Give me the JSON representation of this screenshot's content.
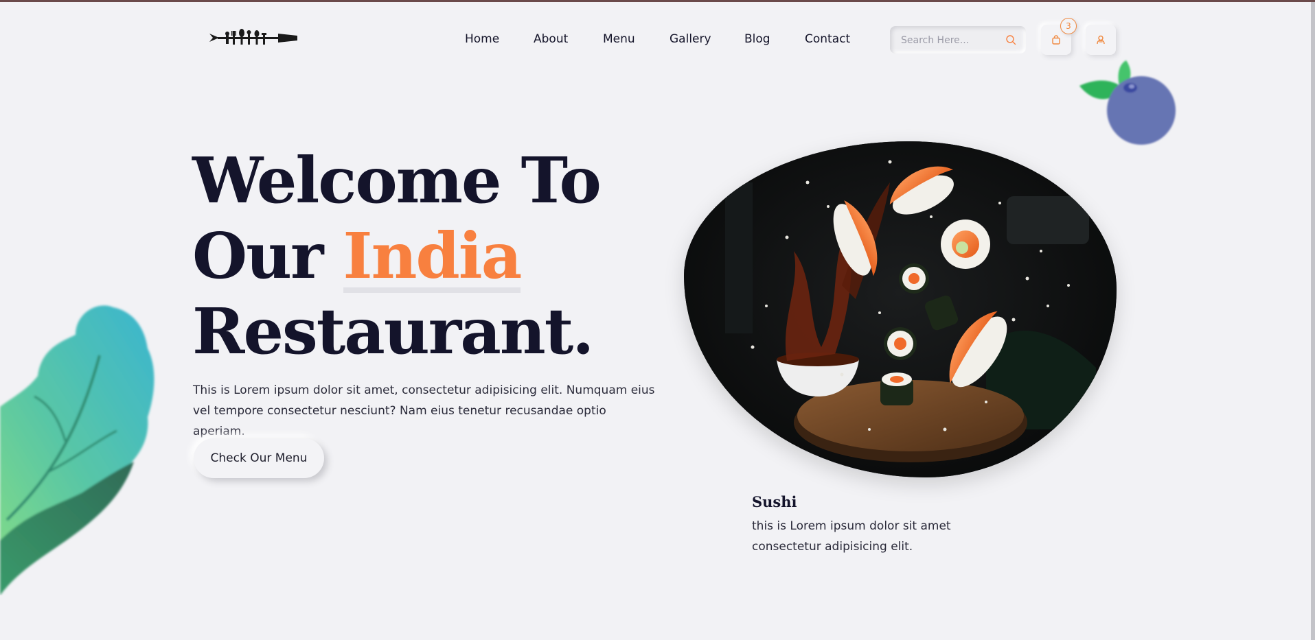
{
  "header": {
    "nav": [
      "Home",
      "About",
      "Menu",
      "Gallery",
      "Blog",
      "Contact"
    ],
    "search": {
      "placeholder": "Search Here..."
    },
    "cart": {
      "count": "3"
    },
    "icons": {
      "search": "search-icon",
      "cart": "shopping-bag-icon",
      "user": "user-icon"
    }
  },
  "hero": {
    "title_line1": "Welcome To",
    "title_line2_prefix": "Our ",
    "title_line2_accent": "India",
    "title_line3": "Restaurant.",
    "description": "This is Lorem ipsum dolor sit amet, consectetur adipisicing elit. Numquam eius vel tempore consectetur nesciunt? Nam eius tenetur recusandae optio aperiam.",
    "cta_label": "Check Our Menu"
  },
  "featured": {
    "name": "Sushi",
    "description": "this is Lorem ipsum dolor sit amet consectetur adipisicing elit."
  },
  "colors": {
    "accent": "#f8803f",
    "heading": "#14142b",
    "background": "#f2f2f5"
  }
}
